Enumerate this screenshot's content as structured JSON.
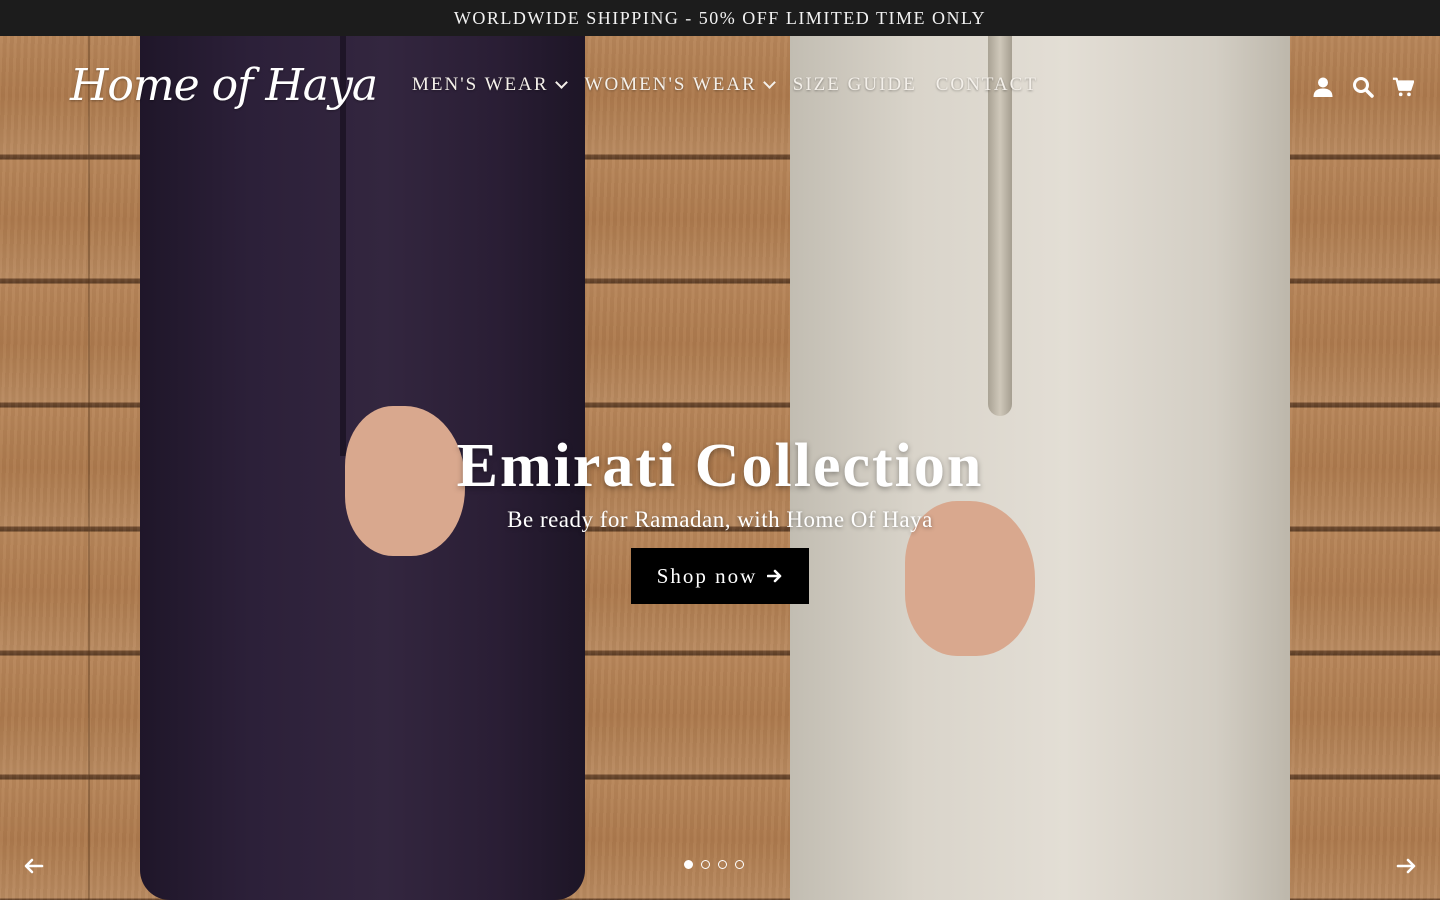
{
  "announcement": {
    "text": "WORLDWIDE SHIPPING - 50% OFF LIMITED TIME ONLY"
  },
  "header": {
    "logo_text": "Home of Haya",
    "nav": [
      {
        "label": "MEN'S WEAR",
        "icon": "chevron-down-icon"
      },
      {
        "label": "WOMEN'S WEAR",
        "icon": "chevron-down-icon"
      },
      {
        "label": "SIZE GUIDE"
      },
      {
        "label": "CONTACT"
      }
    ],
    "icons": [
      "user-icon",
      "search-icon",
      "cart-icon"
    ]
  },
  "hero": {
    "title": "Emirati Collection",
    "subtitle": "Be ready for Ramadan, with Home Of Haya",
    "cta_label": "Shop now",
    "cta_icon": "arrow-right-icon",
    "slides_total": 4,
    "active_slide": 1,
    "prev_icon": "arrow-left-icon",
    "next_icon": "arrow-right-icon"
  },
  "colors": {
    "announcement_bg": "#1c1c1c",
    "cta_bg": "#000000",
    "text_light": "#ffffff"
  }
}
